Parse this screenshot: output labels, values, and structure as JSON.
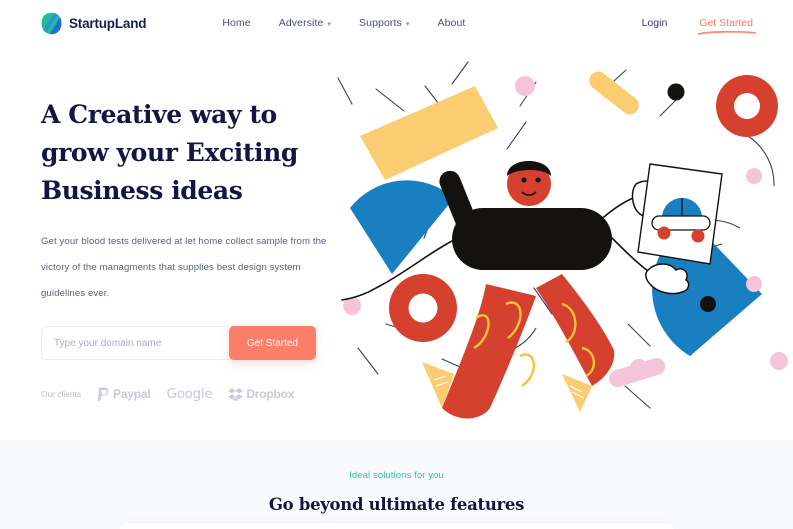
{
  "brand": {
    "name": "StartupLand",
    "logo_icon": "leaf-logo-icon",
    "logo_colors": {
      "teal": "#1fbf9c",
      "blue": "#1f6fd0"
    }
  },
  "nav": {
    "links": [
      {
        "label": "Home",
        "has_dropdown": false
      },
      {
        "label": "Adversite",
        "has_dropdown": true
      },
      {
        "label": "Supports",
        "has_dropdown": true
      },
      {
        "label": "About",
        "has_dropdown": false
      }
    ],
    "caret_glyph": "▾",
    "login_label": "Login",
    "cta_label": "Get Started"
  },
  "hero": {
    "headline_line1": "A Creative way to",
    "headline_line2": "grow your Exciting",
    "headline_line3": "Business ideas",
    "paragraph": "Get your blood tests delivered at let home collect sample from the victory of the managments that supplies best design system guidelines ever.",
    "input_placeholder": "Type your domain name",
    "input_value": "",
    "cta_label": "Get Started",
    "clients_label": "Our clients",
    "clients": [
      {
        "name": "Paypal",
        "icon": "paypal-icon"
      },
      {
        "name": "Google",
        "icon": "google-wordmark-icon"
      },
      {
        "name": "Dropbox",
        "icon": "dropbox-icon"
      }
    ]
  },
  "illustration": {
    "name": "person-holding-car-sketch-illustration",
    "colors": {
      "yellow": "#fbcc72",
      "blue": "#1a7fc1",
      "red": "#d6412f",
      "pink": "#f6c4d8",
      "black": "#14120f",
      "line": "#3b3f5c"
    }
  },
  "features": {
    "eyebrow": "Ideal solutions for you",
    "eyebrow_color": "#2ec4a5",
    "title": "Go beyond ultimate features"
  },
  "theme": {
    "accent_coral": "#fb7e68",
    "navy": "#141544",
    "teal": "#2ec4a5",
    "section_bg": "#f8fafc"
  }
}
